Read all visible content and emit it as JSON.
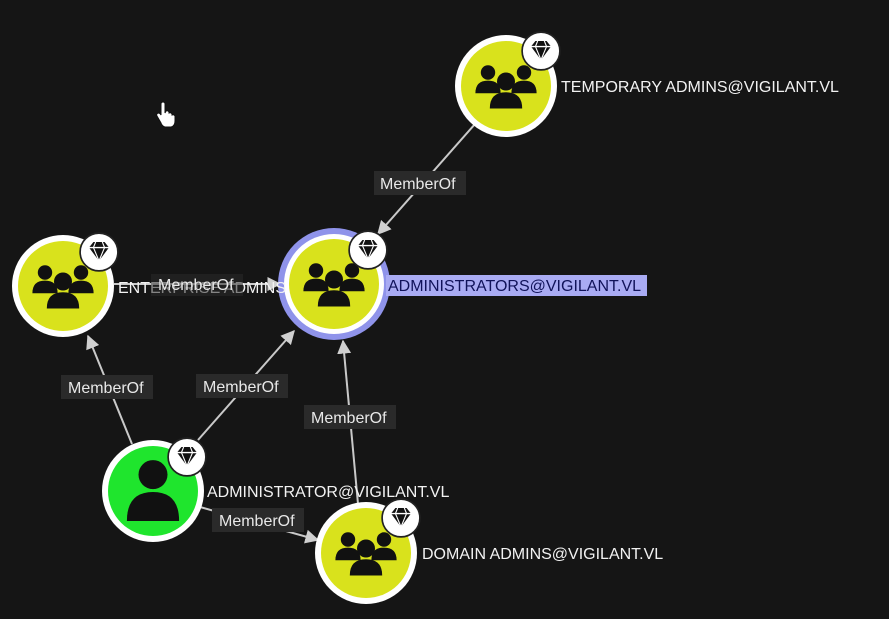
{
  "colors": {
    "background": "#151515",
    "group_node": "#d9e21c",
    "user_node": "#1fe52d",
    "node_ring": "#ffffff",
    "selected_ring": "#8f93ea",
    "selected_label_bg": "#a9abf3",
    "edge": "#c9c9c9",
    "edge_label_bg": "#2a2a2a"
  },
  "icons": {
    "group": "users-group-icon",
    "user": "user-icon",
    "badge": "diamond-gem-icon",
    "cursor": "hand-pointer-icon"
  },
  "nodes": [
    {
      "id": "temporary-admins",
      "label": "TEMPORARY ADMINS@VIGILANT.VL",
      "kind": "group",
      "selected": false
    },
    {
      "id": "administrators",
      "label": "ADMINISTRATORS@VIGILANT.VL",
      "kind": "group",
      "selected": true
    },
    {
      "id": "enterprise-admins",
      "label": "ENTERPRISE ADMINS",
      "kind": "group",
      "selected": false
    },
    {
      "id": "administrator",
      "label": "ADMINISTRATOR@VIGILANT.VL",
      "kind": "user",
      "selected": false
    },
    {
      "id": "domain-admins",
      "label": "DOMAIN ADMINS@VIGILANT.VL",
      "kind": "group",
      "selected": false
    }
  ],
  "edges": [
    {
      "id": "temp-to-admins",
      "from": "temporary-admins",
      "to": "administrators",
      "label": "MemberOf"
    },
    {
      "id": "enterprise-to-admins",
      "from": "enterprise-admins",
      "to": "administrators",
      "label": "MemberOf"
    },
    {
      "id": "administrator-to-enterprise",
      "from": "administrator",
      "to": "enterprise-admins",
      "label": "MemberOf"
    },
    {
      "id": "administrator-to-admins",
      "from": "administrator",
      "to": "administrators",
      "label": "MemberOf"
    },
    {
      "id": "domain-to-admins",
      "from": "domain-admins",
      "to": "administrators",
      "label": "MemberOf"
    },
    {
      "id": "administrator-to-domain",
      "from": "administrator",
      "to": "domain-admins",
      "label": "MemberOf"
    }
  ]
}
